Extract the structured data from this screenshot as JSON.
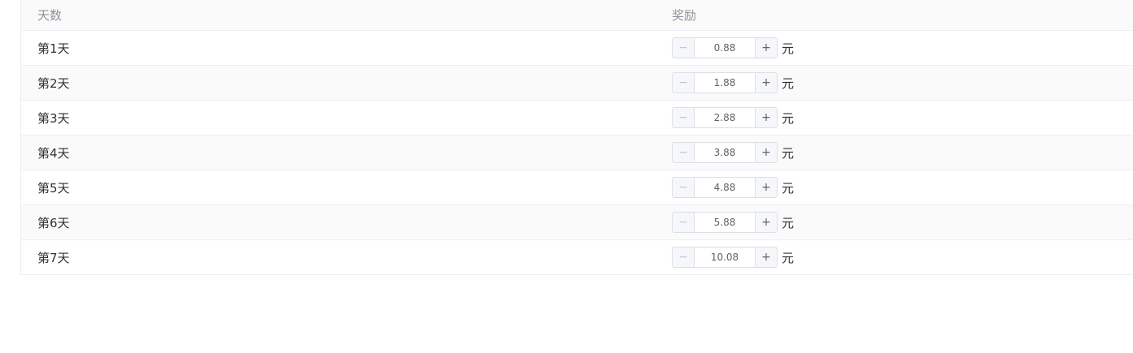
{
  "table": {
    "headers": {
      "day": "天数",
      "reward": "奖励"
    },
    "unit": "元",
    "minus_symbol": "−",
    "plus_symbol": "+",
    "rows": [
      {
        "day": "第1天",
        "value": "0.88"
      },
      {
        "day": "第2天",
        "value": "1.88"
      },
      {
        "day": "第3天",
        "value": "2.88"
      },
      {
        "day": "第4天",
        "value": "3.88"
      },
      {
        "day": "第5天",
        "value": "4.88"
      },
      {
        "day": "第6天",
        "value": "5.88"
      },
      {
        "day": "第7天",
        "value": "10.08"
      }
    ]
  }
}
